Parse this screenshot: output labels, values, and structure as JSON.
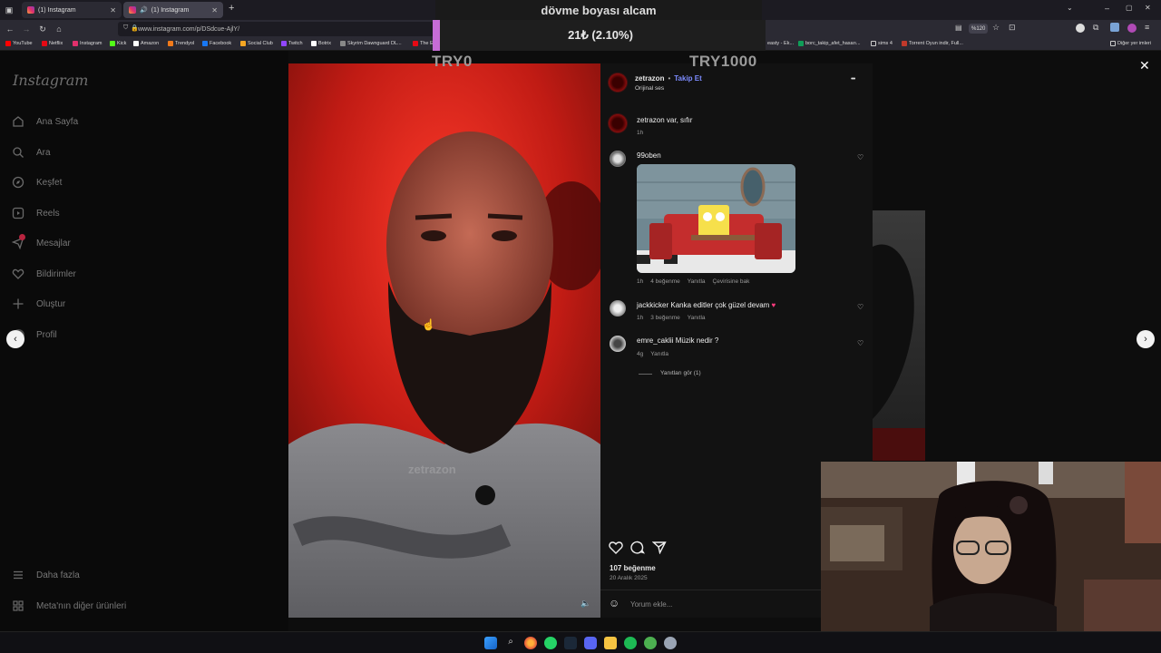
{
  "browser": {
    "tabs": [
      {
        "label": "(1) Instagram",
        "active": false
      },
      {
        "label": "(1) Instagram",
        "active": true
      }
    ],
    "new_tab": "+",
    "url": "www.instagram.com/p/DSdcue-AjlY/",
    "zoom": "%120",
    "other_bookmarks": "Diğer yer imleri",
    "bookmarks": [
      {
        "label": "YouTube",
        "color": "#ff0000"
      },
      {
        "label": "Netflix",
        "color": "#e50914"
      },
      {
        "label": "Instagram",
        "color": "#e1306c"
      },
      {
        "label": "Kick",
        "color": "#53fc18"
      },
      {
        "label": "Amazon",
        "color": "#ffffff"
      },
      {
        "label": "Trendyol",
        "color": "#f27a1a"
      },
      {
        "label": "Facebook",
        "color": "#1877f2"
      },
      {
        "label": "Social Club",
        "color": "#f5a623"
      },
      {
        "label": "Twitch",
        "color": "#9146ff"
      },
      {
        "label": "Botrix",
        "color": "#ffffff"
      },
      {
        "label": "Skyrim Dawnguard DL...",
        "color": "#888888"
      },
      {
        "label": "The E",
        "color": "#e50914"
      }
    ],
    "bookmarks_right": [
      {
        "label": "easty - Ek..."
      },
      {
        "label": "borc_takip_afet_hasarı..."
      },
      {
        "label": "sims 4"
      },
      {
        "label": "Torrent Oyun indir, Full..."
      }
    ]
  },
  "overlay": {
    "title": "dövme boyası alcam",
    "progress_text": "21₺ (2.10%)",
    "progress_percent": 2.1,
    "min_label": "TRY0",
    "max_label": "TRY1000",
    "fill_color": "#c66cd6"
  },
  "sidebar": {
    "logo": "Instagram",
    "items": [
      {
        "label": "Ana Sayfa",
        "icon": "home-icon"
      },
      {
        "label": "Ara",
        "icon": "search-icon"
      },
      {
        "label": "Keşfet",
        "icon": "compass-icon"
      },
      {
        "label": "Reels",
        "icon": "reels-icon"
      },
      {
        "label": "Mesajlar",
        "icon": "messenger-icon"
      },
      {
        "label": "Bildirimler",
        "icon": "heart-icon"
      },
      {
        "label": "Oluştur",
        "icon": "plus-icon"
      },
      {
        "label": "Profil",
        "icon": "avatar-icon"
      }
    ],
    "bottom_items": [
      {
        "label": "Daha fazla",
        "icon": "menu-icon"
      },
      {
        "label": "Meta'nın diğer ürünleri",
        "icon": "grid-icon"
      }
    ]
  },
  "post": {
    "author": "zetrazon",
    "separator": "•",
    "follow": "Takip Et",
    "audio": "Orijinal ses",
    "more": "•••",
    "watermark": "zetrazon",
    "caption": {
      "user": "zetrazon",
      "text": "var, sıfır",
      "time": "1h"
    },
    "comments": [
      {
        "user": "99oben",
        "text": "",
        "time": "1h",
        "likes": "4 beğenme",
        "reply": "Yanıtla",
        "translate": "Çevirisine bak",
        "has_gif": true
      },
      {
        "user": "jackkicker",
        "text": "Kanka editler çok güzel devam",
        "emoji": "♥",
        "time": "1h",
        "likes": "3 beğenme",
        "reply": "Yanıtla"
      },
      {
        "user": "emre_caklii",
        "text": "Müzik nedir ?",
        "time": "4g",
        "reply": "Yanıtla"
      }
    ],
    "view_replies": "Yanıtları gör (1)",
    "likes_count": "107 beğenme",
    "date": "20 Aralık 2025",
    "comment_placeholder": "Yorum ekle..."
  },
  "colors": {
    "follow_blue": "#7d8cff",
    "video_red": "#d21f1a",
    "heart_pink": "#ff3b7f"
  }
}
